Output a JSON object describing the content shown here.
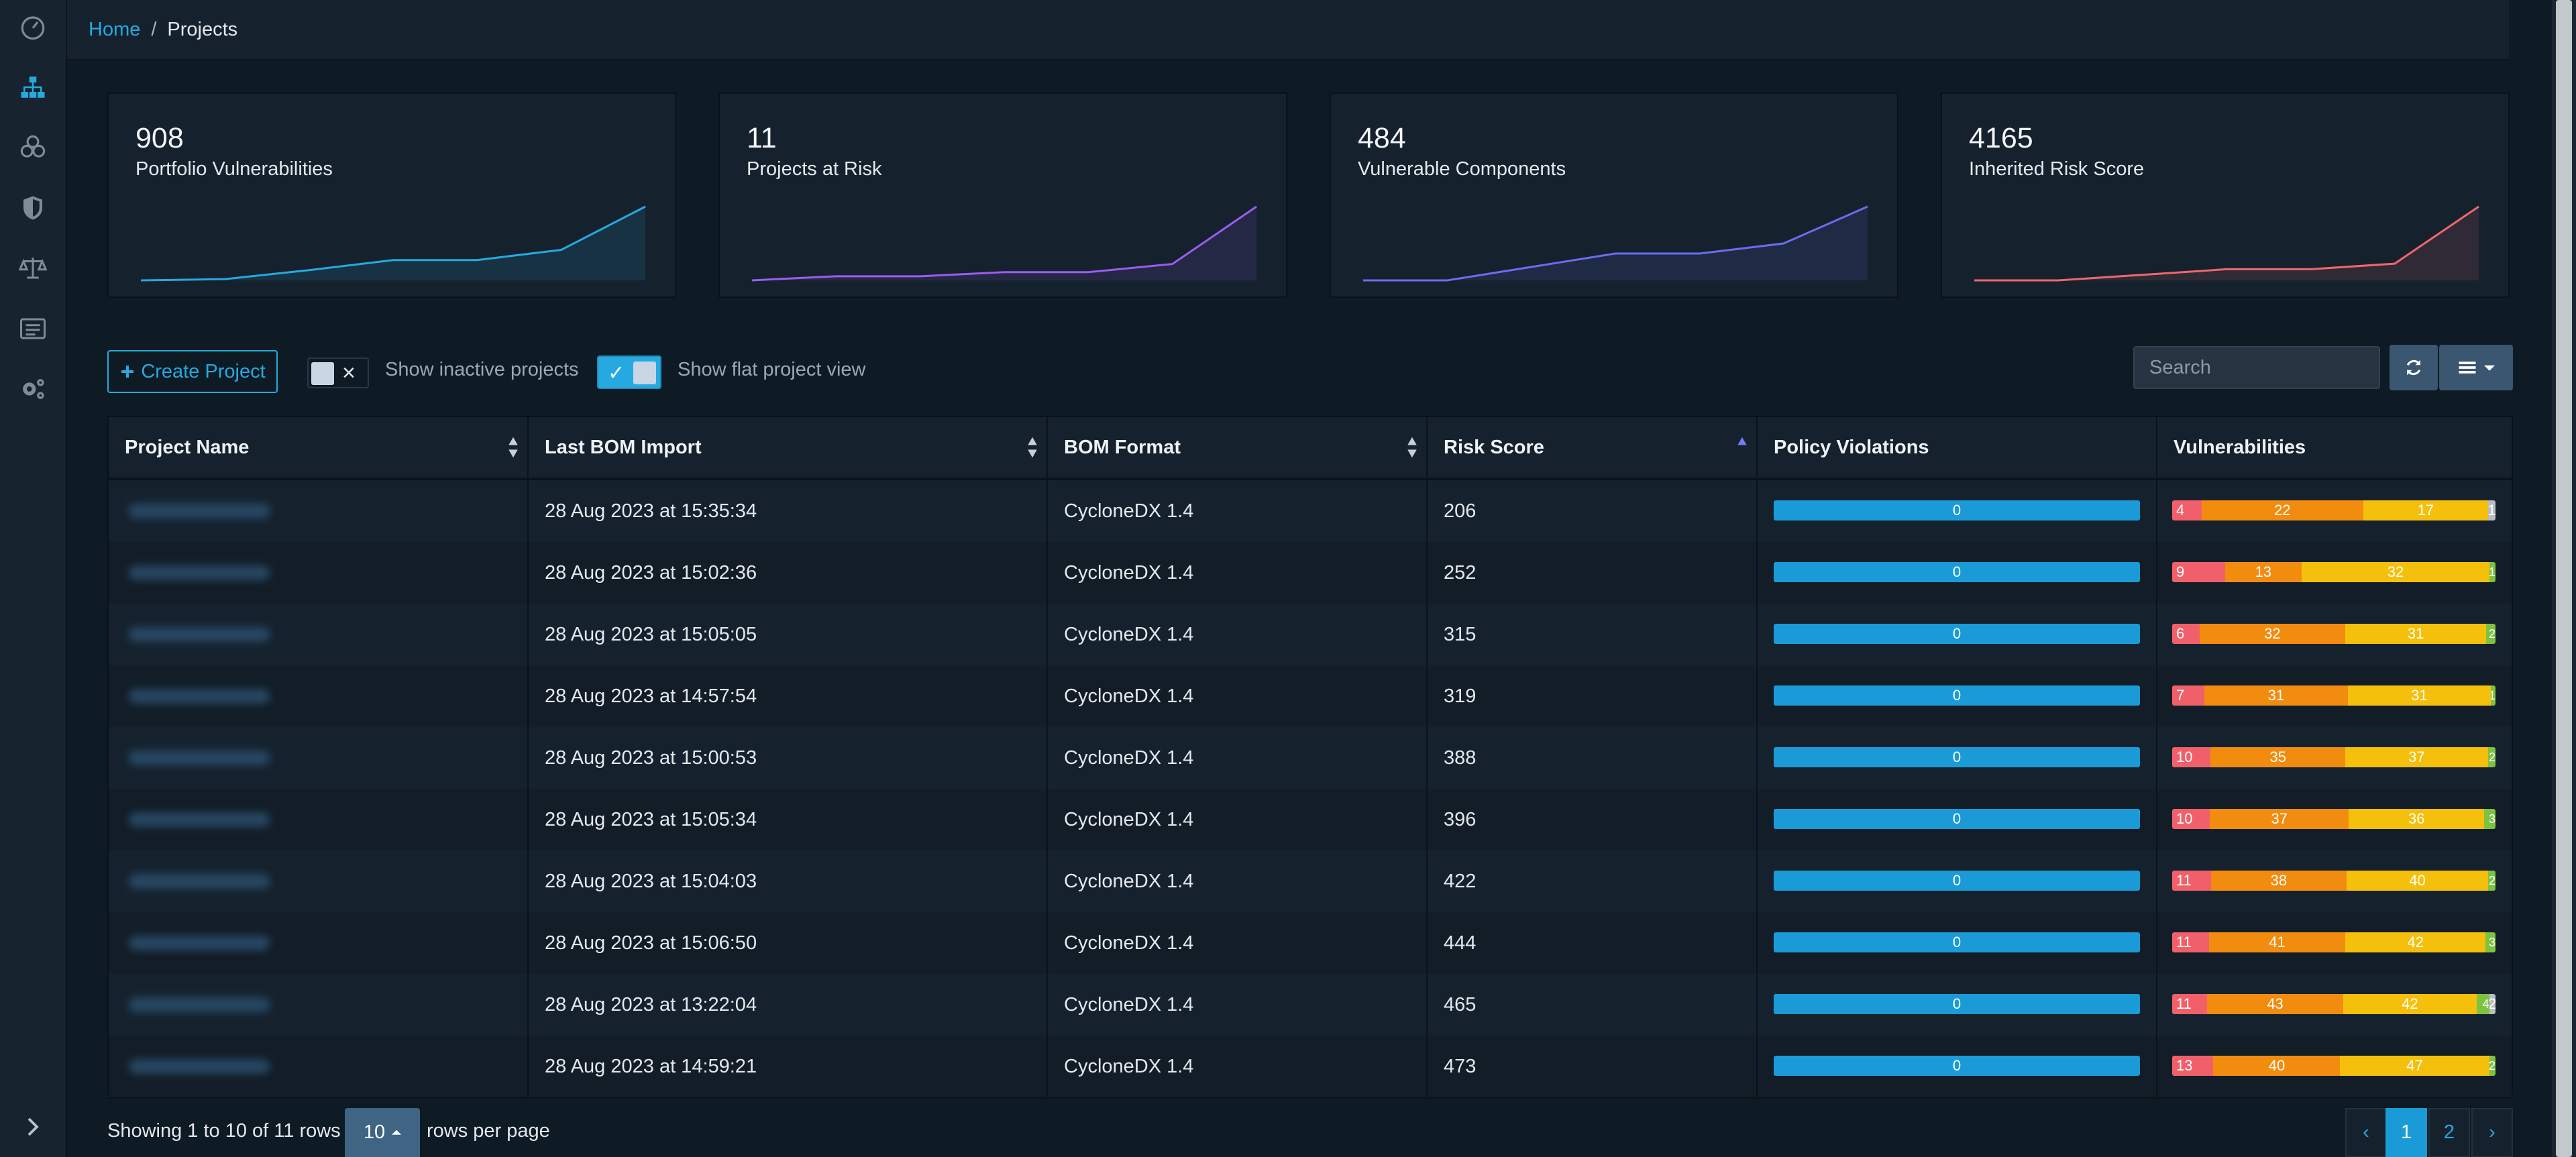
{
  "breadcrumb": {
    "home": "Home",
    "separator": "/",
    "current": "Projects"
  },
  "sidebar": {
    "items": [
      {
        "icon": "dashboard-icon",
        "active": false
      },
      {
        "icon": "sitemap-icon",
        "active": true
      },
      {
        "icon": "components-icon",
        "active": false
      },
      {
        "icon": "shield-icon",
        "active": false
      },
      {
        "icon": "scale-icon",
        "active": false
      },
      {
        "icon": "list-icon",
        "active": false
      },
      {
        "icon": "cogs-icon",
        "active": false
      }
    ],
    "expand_icon": "chevron-right-icon"
  },
  "cards": [
    {
      "value": "908",
      "label": "Portfolio Vulnerabilities",
      "color": "#26a9e0",
      "trend": [
        850,
        851,
        858,
        866,
        866,
        874,
        908
      ]
    },
    {
      "value": "11",
      "label": "Projects at Risk",
      "color": "#9b5cf0",
      "trend": [
        10.1,
        10.15,
        10.15,
        10.2,
        10.2,
        10.3,
        11
      ]
    },
    {
      "value": "484",
      "label": "Vulnerable Components",
      "color": "#6c6cf0",
      "trend": [
        440,
        440,
        448,
        456,
        456,
        462,
        484
      ]
    },
    {
      "value": "4165",
      "label": "Inherited Risk Score",
      "color": "#f0676b",
      "trend": [
        3900,
        3900,
        3920,
        3940,
        3940,
        3960,
        4165
      ]
    }
  ],
  "toolbar": {
    "create_label": "Create Project",
    "inactive_label": "Show inactive projects",
    "flat_label": "Show flat project view",
    "search_placeholder": "Search"
  },
  "table": {
    "headers": [
      "Project Name",
      "Last BOM Import",
      "BOM Format",
      "Risk Score",
      "Policy Violations",
      "Vulnerabilities"
    ],
    "rows": [
      {
        "import": "28 Aug 2023 at 15:35:34",
        "format": "CycloneDX 1.4",
        "risk": "206",
        "policy": "0",
        "vuln": {
          "c": "4",
          "h": "22",
          "m": "17",
          "l": "",
          "u": "1"
        }
      },
      {
        "import": "28 Aug 2023 at 15:02:36",
        "format": "CycloneDX 1.4",
        "risk": "252",
        "policy": "0",
        "vuln": {
          "c": "9",
          "h": "13",
          "m": "32",
          "l": "1",
          "u": ""
        }
      },
      {
        "import": "28 Aug 2023 at 15:05:05",
        "format": "CycloneDX 1.4",
        "risk": "315",
        "policy": "0",
        "vuln": {
          "c": "6",
          "h": "32",
          "m": "31",
          "l": "2",
          "u": ""
        }
      },
      {
        "import": "28 Aug 2023 at 14:57:54",
        "format": "CycloneDX 1.4",
        "risk": "319",
        "policy": "0",
        "vuln": {
          "c": "7",
          "h": "31",
          "m": "31",
          "l": "1",
          "u": ""
        }
      },
      {
        "import": "28 Aug 2023 at 15:00:53",
        "format": "CycloneDX 1.4",
        "risk": "388",
        "policy": "0",
        "vuln": {
          "c": "10",
          "h": "35",
          "m": "37",
          "l": "2",
          "u": ""
        }
      },
      {
        "import": "28 Aug 2023 at 15:05:34",
        "format": "CycloneDX 1.4",
        "risk": "396",
        "policy": "0",
        "vuln": {
          "c": "10",
          "h": "37",
          "m": "36",
          "l": "3",
          "u": ""
        }
      },
      {
        "import": "28 Aug 2023 at 15:04:03",
        "format": "CycloneDX 1.4",
        "risk": "422",
        "policy": "0",
        "vuln": {
          "c": "11",
          "h": "38",
          "m": "40",
          "l": "2",
          "u": ""
        }
      },
      {
        "import": "28 Aug 2023 at 15:06:50",
        "format": "CycloneDX 1.4",
        "risk": "444",
        "policy": "0",
        "vuln": {
          "c": "11",
          "h": "41",
          "m": "42",
          "l": "3",
          "u": ""
        }
      },
      {
        "import": "28 Aug 2023 at 13:22:04",
        "format": "CycloneDX 1.4",
        "risk": "465",
        "policy": "0",
        "vuln": {
          "c": "11",
          "h": "43",
          "m": "42",
          "l": "4",
          "u": "2"
        }
      },
      {
        "import": "28 Aug 2023 at 14:59:21",
        "format": "CycloneDX 1.4",
        "risk": "473",
        "policy": "0",
        "vuln": {
          "c": "13",
          "h": "40",
          "m": "47",
          "l": "2",
          "u": ""
        }
      }
    ]
  },
  "footer": {
    "showing": "Showing 1 to 10 of 11 rows",
    "page_size": "10",
    "rows_per_page": "rows per page",
    "prev": "‹",
    "pages": [
      "1",
      "2"
    ],
    "next": "›"
  },
  "colors": {
    "accent": "#26a9e0",
    "critical": "#f1606a",
    "high": "#f28c0f",
    "medium": "#f5c00c",
    "low": "#7ec241",
    "unassigned": "#b9bec3"
  }
}
